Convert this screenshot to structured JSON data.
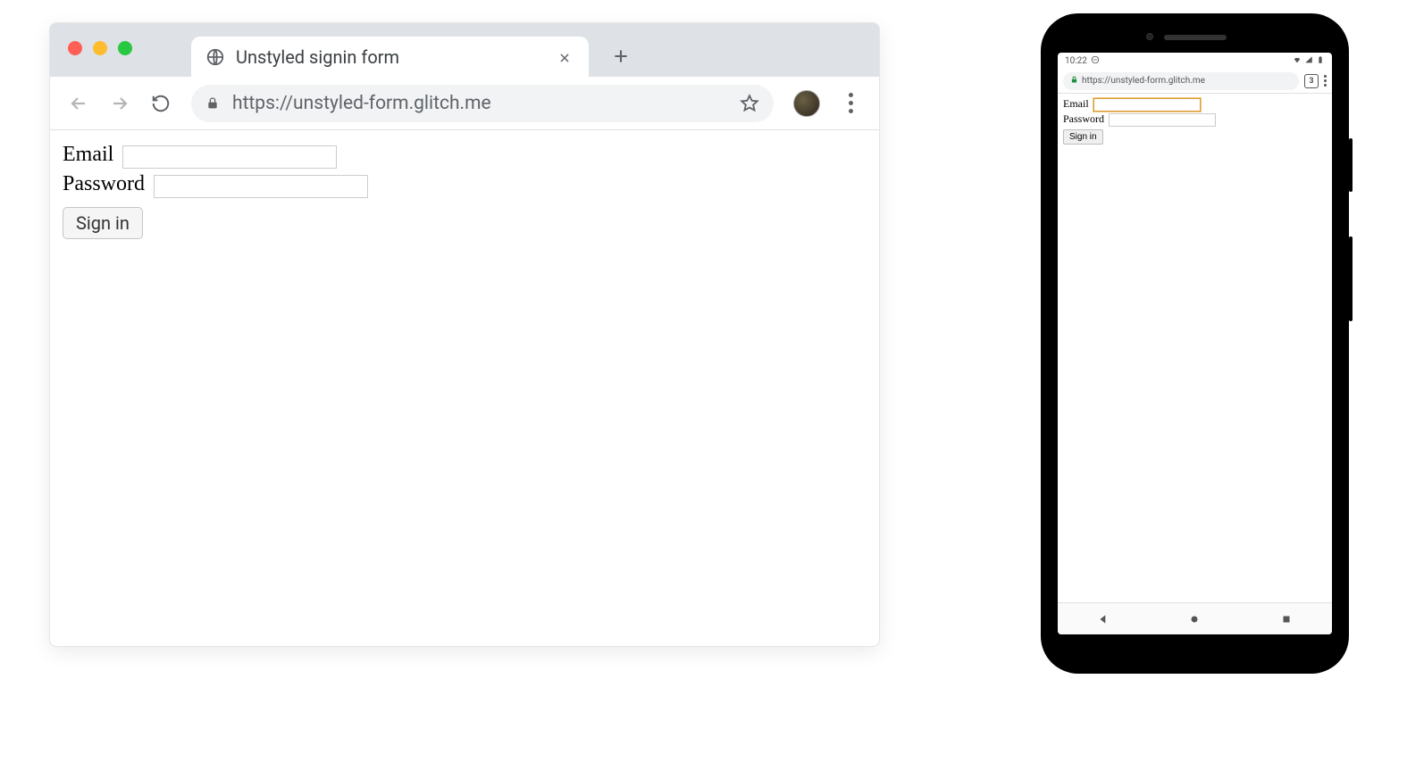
{
  "desktop": {
    "tab_title": "Unstyled signin form",
    "url": "https://unstyled-form.glitch.me",
    "form": {
      "email_label": "Email",
      "password_label": "Password",
      "signin_label": "Sign in"
    }
  },
  "mobile": {
    "time": "10:22",
    "url": "https://unstyled-form.glitch.me",
    "tab_count": "3",
    "form": {
      "email_label": "Email",
      "password_label": "Password",
      "signin_label": "Sign in"
    }
  }
}
